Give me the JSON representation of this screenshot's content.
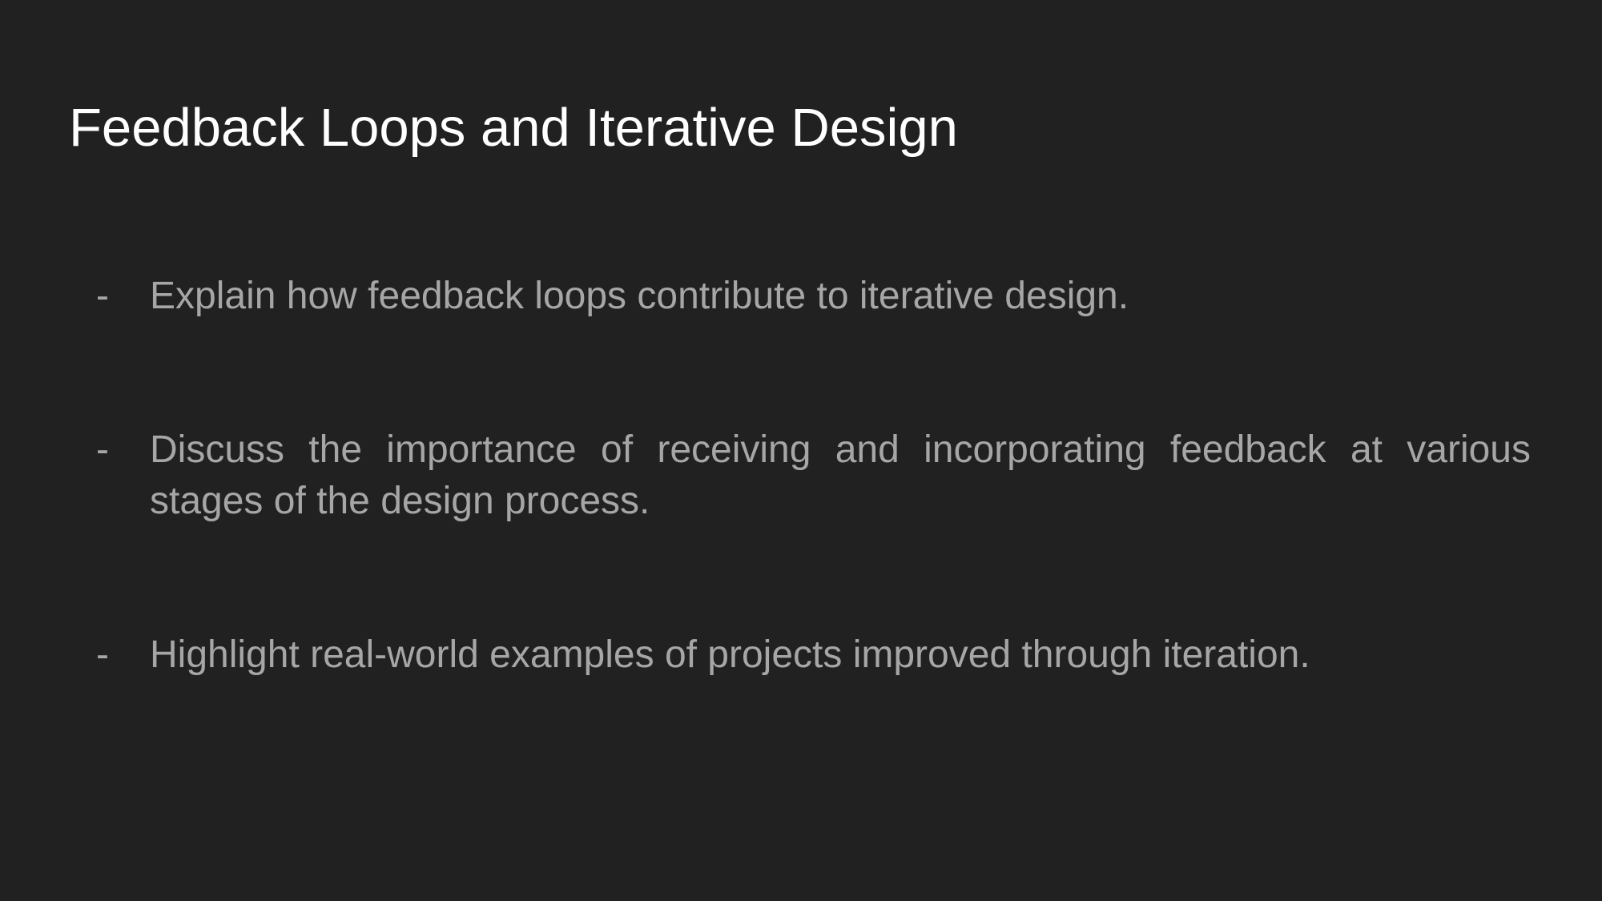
{
  "slide": {
    "title": "Feedback Loops and Iterative Design",
    "bullet_marker": "-",
    "bullets": [
      {
        "text": "Explain how feedback loops contribute to iterative design."
      },
      {
        "text": "Discuss the importance of receiving and incorporating feedback at various stages of the design process."
      },
      {
        "text": "Highlight real-world examples of projects improved through iteration."
      }
    ]
  },
  "colors": {
    "background": "#212121",
    "title": "#ffffff",
    "body_text": "#a6a6a6"
  }
}
